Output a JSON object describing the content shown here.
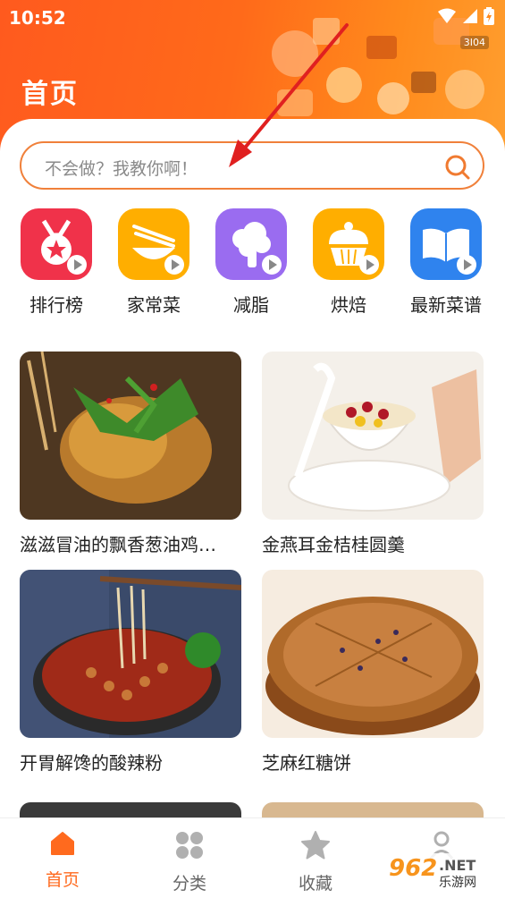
{
  "status_bar": {
    "time": "10:52",
    "network_tag": "3I04"
  },
  "header": {
    "title": "首页"
  },
  "search": {
    "placeholder": "不会做？我教你啊！"
  },
  "categories": [
    {
      "label": "排行榜",
      "icon": "medal-star-icon",
      "color": "#f0324a"
    },
    {
      "label": "家常菜",
      "icon": "noodle-bowl-icon",
      "color": "#ffae00"
    },
    {
      "label": "减脂",
      "icon": "broccoli-icon",
      "color": "#9a6cf0"
    },
    {
      "label": "烘焙",
      "icon": "cupcake-icon",
      "color": "#ffae00"
    },
    {
      "label": "最新菜谱",
      "icon": "open-book-icon",
      "color": "#2f83ee"
    }
  ],
  "recipes": [
    {
      "title": "滋滋冒油的飘香葱油鸡…",
      "image": "roast-chicken-photo"
    },
    {
      "title": "金燕耳金桔桂圆羹",
      "image": "dessert-soup-photo"
    },
    {
      "title": "开胃解馋的酸辣粉",
      "image": "hot-sour-noodles-photo"
    },
    {
      "title": "芝麻红糖饼",
      "image": "sesame-pancake-photo"
    }
  ],
  "tabbar": {
    "tabs": [
      {
        "label": "首页",
        "icon": "home-icon",
        "active": true
      },
      {
        "label": "分类",
        "icon": "grid-icon",
        "active": false
      },
      {
        "label": "收藏",
        "icon": "star-icon",
        "active": false
      },
      {
        "label": "",
        "icon": "user-icon",
        "active": false
      }
    ]
  },
  "watermark": {
    "number": "962",
    "net": ".NET",
    "site": "乐游网"
  },
  "colors": {
    "accent": "#ff6a1e",
    "search_border": "#f0803a",
    "arrow": "#e02020"
  }
}
